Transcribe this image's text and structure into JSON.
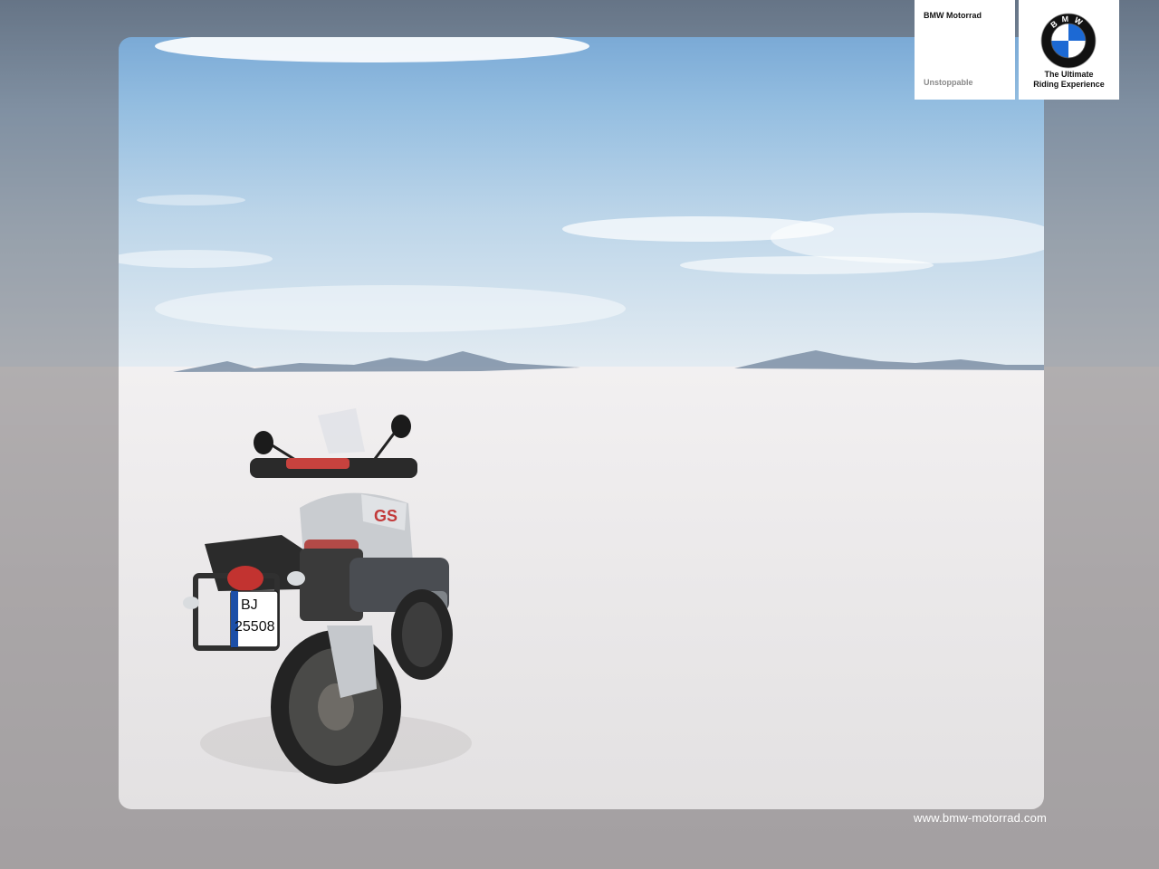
{
  "brand": {
    "name": "BMW Motorrad",
    "tagline": "Unstoppable"
  },
  "badge": {
    "logo_letters": "BMW",
    "slogan_line1": "The Ultimate",
    "slogan_line2": "Riding Experience"
  },
  "photo": {
    "license_plate_line1": "BJ",
    "license_plate_line2": "25508",
    "tank_badge": "GS"
  },
  "footer": {
    "website": "www.bmw-motorrad.com"
  },
  "colors": {
    "bmw_blue": "#1c69d4",
    "frame_border": "#ffffff"
  }
}
